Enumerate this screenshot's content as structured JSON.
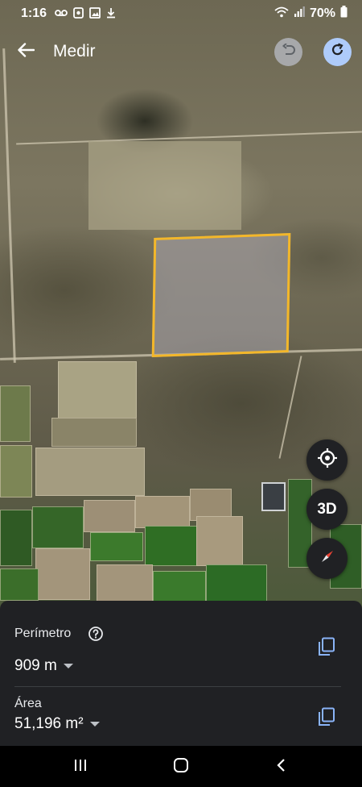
{
  "status_bar": {
    "time": "1:16",
    "left_icons": [
      "voicemail-icon",
      "app-icon",
      "gallery-icon",
      "download-icon"
    ],
    "right_icons": [
      "wifi-icon",
      "signal-icon"
    ],
    "battery": "70%"
  },
  "header": {
    "title": "Medir",
    "back_icon": "arrow-back-icon",
    "undo_icon": "undo-icon",
    "redo_icon": "redo-icon"
  },
  "map_controls": {
    "location_icon": "my-location-icon",
    "view_3d_label": "3D",
    "compass_icon": "compass-icon"
  },
  "measurement": {
    "perimeter_label": "Perímetro",
    "perimeter_value": "909 m",
    "area_label": "Área",
    "area_value": "51,196 m²"
  },
  "colors": {
    "selection_border": "#f3b72a",
    "sheet_bg": "#202124",
    "redo_bg": "#aecbfa",
    "undo_bg": "#a7a8aa",
    "copy_icon": "#8ab4f8"
  },
  "nav_bar": {
    "items": [
      "recents-icon",
      "home-icon",
      "back-icon"
    ]
  }
}
